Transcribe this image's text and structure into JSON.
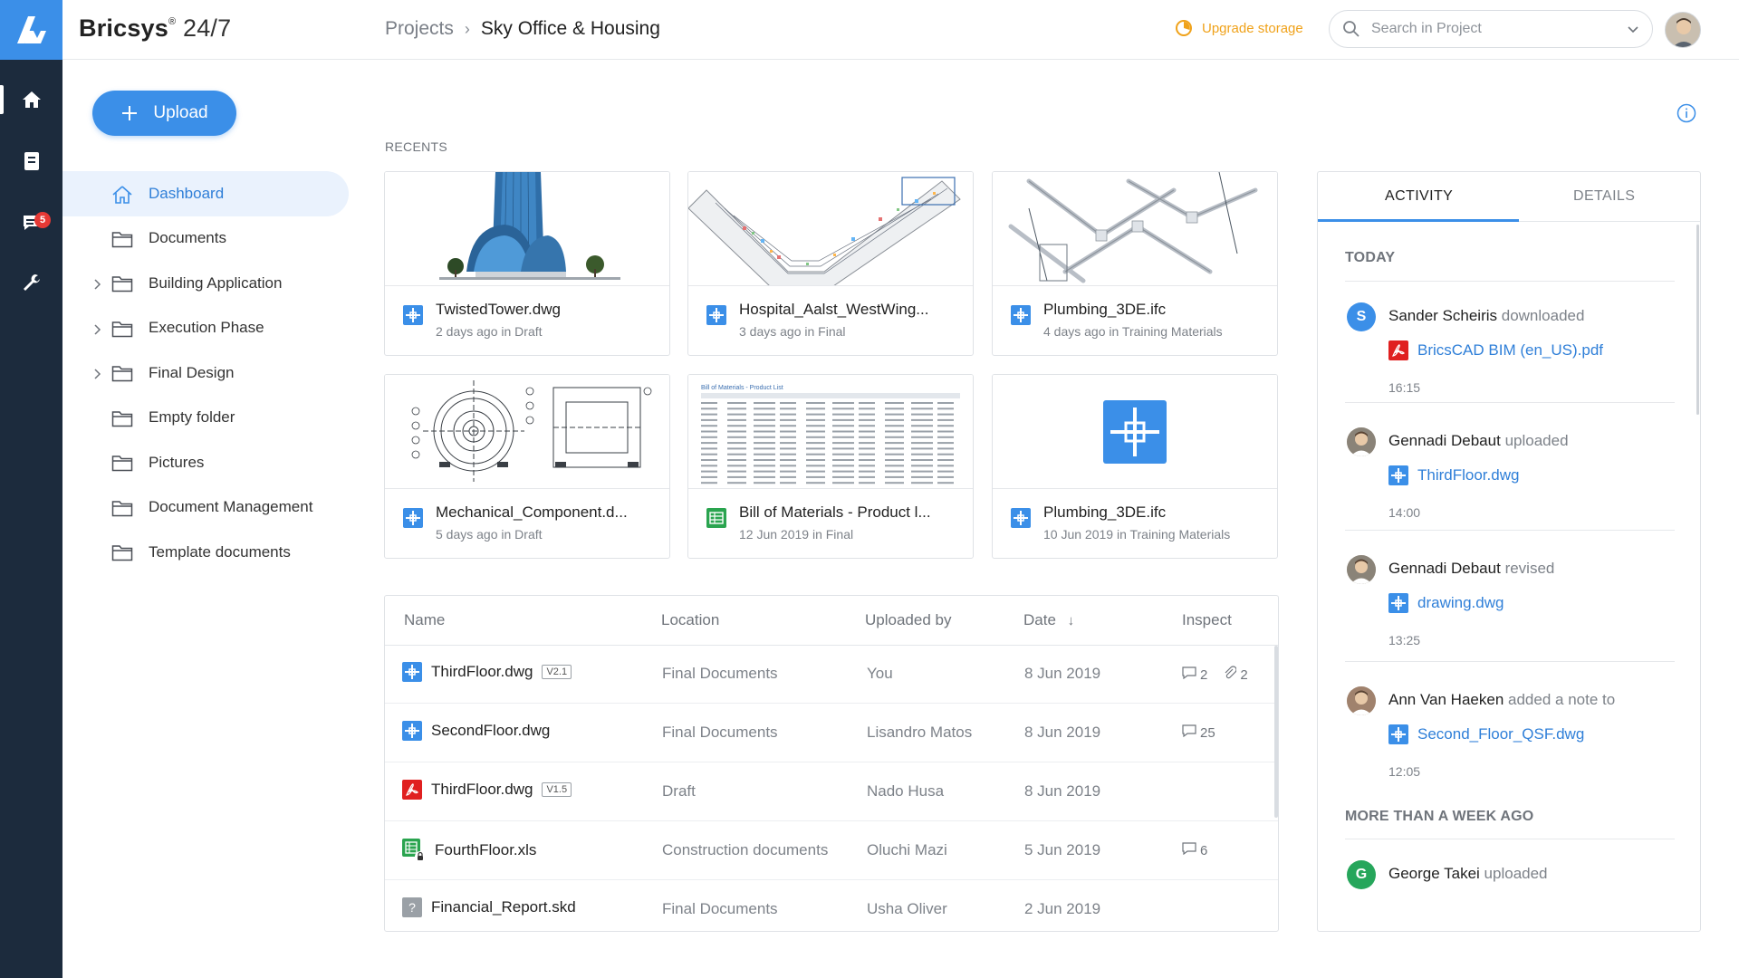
{
  "app": {
    "brand_bold": "Bricsys",
    "brand_reg": "®",
    "brand_light": " 24/7"
  },
  "rail": {
    "messages_badge": "5"
  },
  "breadcrumb": {
    "root": "Projects",
    "separator": "›",
    "current": "Sky Office & Housing"
  },
  "header": {
    "upgrade_label": "Upgrade storage",
    "search_placeholder": "Search in Project"
  },
  "upload": {
    "label": "Upload"
  },
  "nav": {
    "items": [
      {
        "label": "Dashboard",
        "active": true,
        "expandable": false,
        "icon": "home-icon"
      },
      {
        "label": "Documents",
        "expandable": false,
        "icon": "folder-icon"
      },
      {
        "label": "Building Application",
        "expandable": true,
        "icon": "folder-icon"
      },
      {
        "label": "Execution Phase",
        "expandable": true,
        "icon": "folder-icon"
      },
      {
        "label": "Final Design",
        "expandable": true,
        "icon": "folder-icon"
      },
      {
        "label": "Empty folder",
        "expandable": false,
        "icon": "folder-icon"
      },
      {
        "label": "Pictures",
        "expandable": false,
        "icon": "folder-icon"
      },
      {
        "label": "Document Management",
        "expandable": false,
        "icon": "folder-icon"
      },
      {
        "label": "Template documents",
        "expandable": false,
        "icon": "folder-icon"
      }
    ]
  },
  "recents": {
    "title": "RECENTS",
    "cards": [
      {
        "name": "TwistedTower.dwg",
        "sub": "2 days ago in Draft",
        "icon": "dwg-file-icon"
      },
      {
        "name": "Hospital_Aalst_WestWing...",
        "sub": "3 days ago in Final",
        "icon": "dwg-file-icon"
      },
      {
        "name": "Plumbing_3DE.ifc",
        "sub": "4 days ago in Training Materials",
        "icon": "dwg-file-icon"
      },
      {
        "name": "Mechanical_Component.d...",
        "sub": "5 days ago in Draft",
        "icon": "dwg-file-icon"
      },
      {
        "name": "Bill of Materials - Product l...",
        "sub": "12 Jun 2019 in Final",
        "icon": "spreadsheet-file-icon"
      },
      {
        "name": "Plumbing_3DE.ifc",
        "sub": "10 Jun 2019 in Training Materials",
        "icon": "dwg-file-icon"
      }
    ],
    "thumb_bom_title": "Bill of Materials - Product List"
  },
  "table": {
    "headers": {
      "name": "Name",
      "location": "Location",
      "uploaded_by": "Uploaded by",
      "date": "Date",
      "date_sort": "↓",
      "inspect": "Inspect"
    },
    "rows": [
      {
        "name": "ThirdFloor.dwg",
        "version": "V2.1",
        "location": "Final Documents",
        "by": "You",
        "date": "8 Jun 2019",
        "comments": "2",
        "attachments": "2",
        "icon": "dwg-file-icon"
      },
      {
        "name": "SecondFloor.dwg",
        "version": "",
        "location": "Final Documents",
        "by": "Lisandro Matos",
        "date": "8 Jun 2019",
        "comments": "25",
        "attachments": "",
        "icon": "dwg-file-icon"
      },
      {
        "name": "ThirdFloor.dwg",
        "version": "V1.5",
        "location": "Draft",
        "by": "Nado Husa",
        "date": "8 Jun 2019",
        "comments": "",
        "attachments": "",
        "icon": "pdf-file-icon"
      },
      {
        "name": "FourthFloor.xls",
        "version": "",
        "location": "Construction documents",
        "by": "Oluchi Mazi",
        "date": "5 Jun 2019",
        "comments": "6",
        "attachments": "",
        "icon": "locked-spreadsheet-icon"
      },
      {
        "name": "Financial_Report.skd",
        "version": "",
        "location": "Final Documents",
        "by": "Usha Oliver",
        "date": "2 Jun 2019",
        "comments": "",
        "attachments": "",
        "icon": "unknown-file-icon"
      }
    ]
  },
  "panel": {
    "tab_activity": "ACTIVITY",
    "tab_details": "DETAILS",
    "today_label": "TODAY",
    "older_label": "MORE THAN A WEEK AGO",
    "activities": [
      {
        "initial": "S",
        "who": "Sander Scheiris",
        "verb": "downloaded",
        "file": "BricsCAD BIM (en_US).pdf",
        "file_icon": "pdf-file-icon",
        "time": "16:15",
        "avatar_color": "#3b8fe8"
      },
      {
        "initial": "",
        "who": "Gennadi Debaut",
        "verb": "uploaded",
        "file": "ThirdFloor.dwg",
        "file_icon": "dwg-file-icon",
        "time": "14:00",
        "avatar_color": "#8a8378"
      },
      {
        "initial": "",
        "who": "Gennadi Debaut",
        "verb": "revised",
        "file": "drawing.dwg",
        "file_icon": "dwg-file-icon",
        "time": "13:25",
        "avatar_color": "#8a8378"
      },
      {
        "initial": "",
        "who": "Ann Van Haeken",
        "verb": "added a note to",
        "file": "Second_Floor_QSF.dwg",
        "file_icon": "dwg-file-icon",
        "time": "12:05",
        "avatar_color": "#a0826d"
      }
    ],
    "older": [
      {
        "initial": "G",
        "who": "George Takei",
        "verb": "uploaded",
        "avatar_color": "#26a65b"
      }
    ]
  },
  "colors": {
    "accent": "#3b8fe8",
    "rail": "#1c2b3d",
    "upgrade": "#f0a21a",
    "pdf": "#e02020",
    "sheet": "#2aa44f"
  }
}
